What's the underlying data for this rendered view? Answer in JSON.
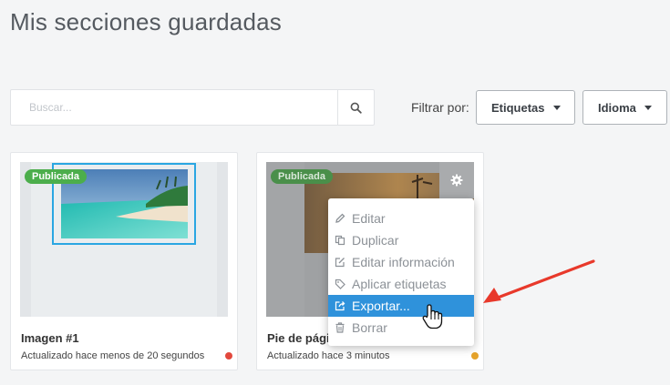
{
  "page": {
    "title": "Mis secciones guardadas"
  },
  "search": {
    "placeholder": "Buscar..."
  },
  "filter": {
    "label": "Filtrar por:",
    "dropdowns": [
      {
        "label": "Etiquetas"
      },
      {
        "label": "Idioma"
      }
    ]
  },
  "cards": [
    {
      "name": "Imagen #1",
      "updated": "Actualizado hace menos de 20 segundos",
      "badge": "Publicada",
      "status_color": "#e2483d"
    },
    {
      "name": "Pie de página",
      "updated": "Actualizado hace 3 minutos",
      "badge": "Publicada",
      "status_color": "#e5a32b"
    }
  ],
  "menu": {
    "items": [
      {
        "label": "Editar",
        "icon": "pencil-icon"
      },
      {
        "label": "Duplicar",
        "icon": "copy-icon"
      },
      {
        "label": "Editar información",
        "icon": "edit-icon"
      },
      {
        "label": "Aplicar etiquetas",
        "icon": "tag-icon"
      },
      {
        "label": "Exportar...",
        "icon": "export-icon"
      },
      {
        "label": "Borrar",
        "icon": "trash-icon"
      }
    ],
    "active_item": "Exportar..."
  },
  "colors": {
    "badge": "#4cae4c",
    "menu_active": "#2f92db",
    "annotation_arrow": "#e8392b"
  }
}
